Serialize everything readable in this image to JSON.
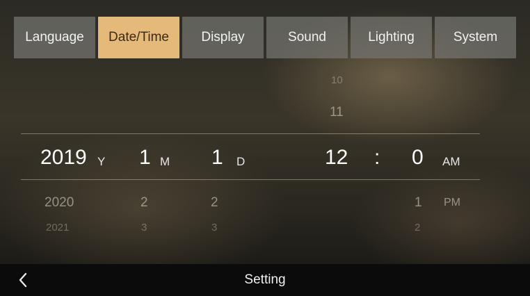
{
  "tabs": [
    "Language",
    "Date/Time",
    "Display",
    "Sound",
    "Lighting",
    "System"
  ],
  "active_tab": "Date/Time",
  "picker": {
    "hour_above": [
      "10",
      "11"
    ],
    "year": {
      "value": "2019",
      "unit": "Y",
      "below": [
        "2020",
        "2021"
      ]
    },
    "month": {
      "value": "1",
      "unit": "M",
      "below": [
        "2",
        "3"
      ]
    },
    "day": {
      "value": "1",
      "unit": "D",
      "below": [
        "2",
        "3"
      ]
    },
    "hour": {
      "value": "12"
    },
    "separator": ":",
    "minute": {
      "value": "0",
      "below": [
        "1",
        "2"
      ]
    },
    "ampm": {
      "value": "AM",
      "below": [
        "PM"
      ]
    }
  },
  "bottom_bar": {
    "title": "Setting",
    "back_icon": "chevron-left-icon"
  },
  "colors": {
    "active_tab": "#e5b979",
    "tab": "#73736e",
    "bar": "#0b0b0b"
  }
}
